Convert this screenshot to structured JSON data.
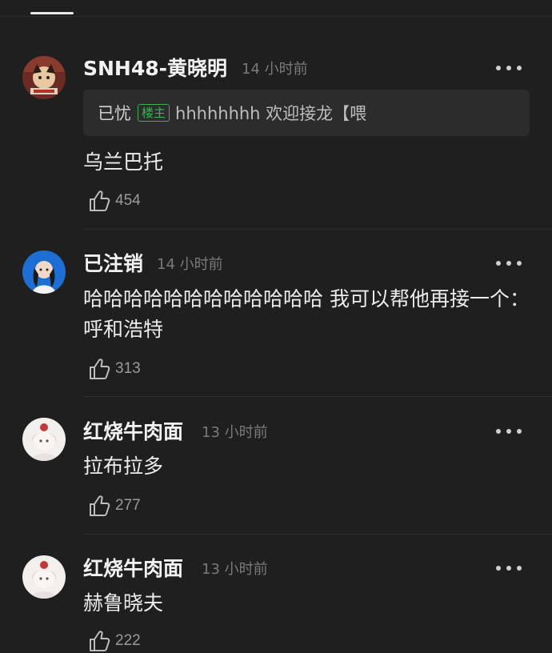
{
  "comments": [
    {
      "username": "SNH48-黄晓明",
      "time": "14 小时前",
      "quote": {
        "user": "已忧",
        "badge": "楼主",
        "text": "hhhhhhhh 欢迎接龙【喂"
      },
      "text": "乌兰巴托",
      "likes": "454"
    },
    {
      "username": "已注销",
      "time": "14 小时前",
      "text": "哈哈哈哈哈哈哈哈哈哈哈哈 我可以帮他再接一个：呼和浩特",
      "likes": "313"
    },
    {
      "username": "红烧牛肉面",
      "time": "13 小时前",
      "text": "拉布拉多",
      "likes": "277"
    },
    {
      "username": "红烧牛肉面",
      "time": "13 小时前",
      "text": "赫鲁晓夫",
      "likes": "222"
    }
  ]
}
